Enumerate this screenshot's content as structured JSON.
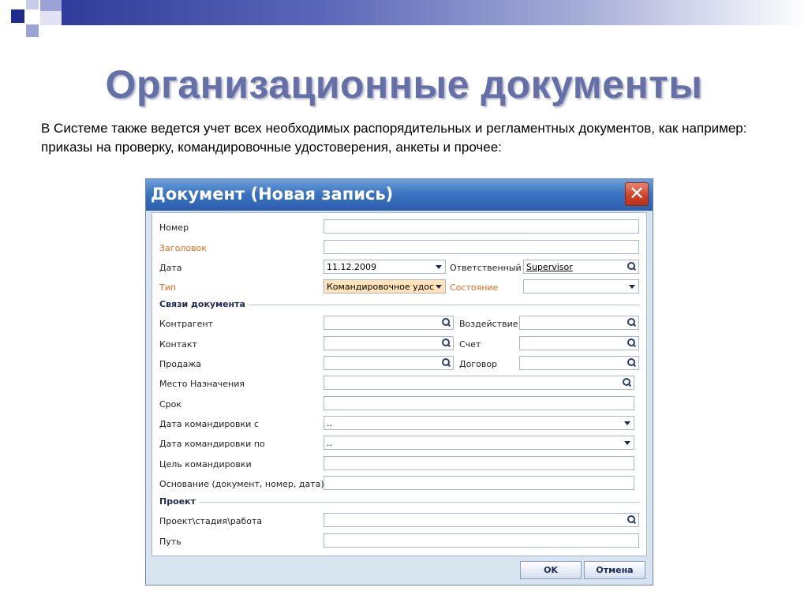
{
  "slide": {
    "title": "Организационные документы",
    "body": "В Системе также ведется учет всех необходимых распорядительных и регламентных документов, как например: приказы на проверку, командировочные удостоверения, анкеты и прочее:"
  },
  "dialog": {
    "title": "Документ (Новая запись)",
    "close_label": "✕",
    "fields": {
      "nomer": {
        "label": "Номер",
        "value": ""
      },
      "zagolovok": {
        "label": "Заголовок",
        "value": ""
      },
      "data": {
        "label": "Дата",
        "value": "11.12.2009"
      },
      "otvetstvenny": {
        "label": "Ответственный",
        "value": "Supervisor"
      },
      "tip": {
        "label": "Тип",
        "value": "Командировочное удос"
      },
      "sostoyanie": {
        "label": "Состояние",
        "value": ""
      }
    },
    "section_links": "Связи документа",
    "links": {
      "kontragent": {
        "label": "Контрагент",
        "value": ""
      },
      "vozdeystvie": {
        "label": "Воздействие",
        "value": ""
      },
      "kontakt": {
        "label": "Контакт",
        "value": ""
      },
      "schet": {
        "label": "Счет",
        "value": ""
      },
      "prodazha": {
        "label": "Продажа",
        "value": ""
      },
      "dogovor": {
        "label": "Договор",
        "value": ""
      },
      "mesto": {
        "label": "Место Назначения",
        "value": ""
      },
      "srok": {
        "label": "Срок",
        "value": ""
      },
      "data_s": {
        "label": "Дата командировки с",
        "value": ".."
      },
      "data_po": {
        "label": "Дата командировки по",
        "value": ".."
      },
      "cel": {
        "label": "Цель командировки",
        "value": ""
      },
      "osnovanie": {
        "label": "Основание (документ, номер, дата):",
        "value": ""
      }
    },
    "section_project": "Проект",
    "project": {
      "stadiya": {
        "label": "Проект\\стадия\\работа",
        "value": ""
      },
      "put": {
        "label": "Путь",
        "value": ""
      }
    },
    "buttons": {
      "ok": "OK",
      "cancel": "Отмена"
    }
  },
  "colors": {
    "title_text": "#6670a8",
    "titlebar": "#3b74c2",
    "required_label": "#e46a1a",
    "type_field_bg": "#fde3b5"
  }
}
